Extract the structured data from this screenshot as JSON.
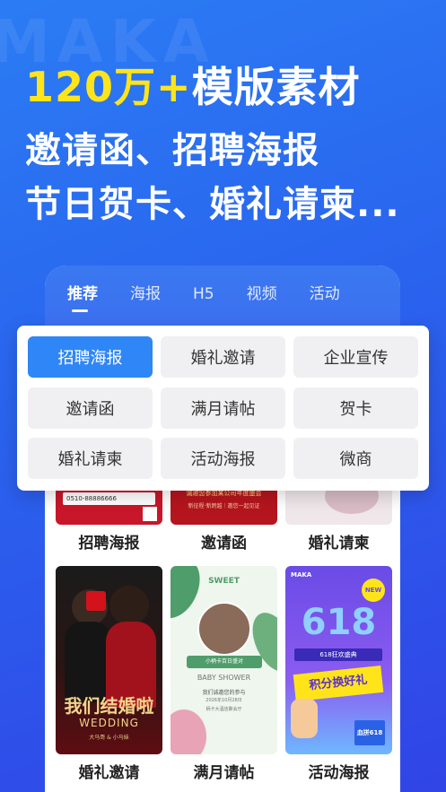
{
  "watermark": "MAKA",
  "hero": {
    "line1_accent": "120万+",
    "line1_rest": "模版素材",
    "line2": "邀请函、招聘海报",
    "line3": "节日贺卡、婚礼请柬..."
  },
  "tabs": [
    {
      "label": "推荐"
    },
    {
      "label": "海报"
    },
    {
      "label": "H5"
    },
    {
      "label": "视频"
    },
    {
      "label": "活动"
    }
  ],
  "categories": [
    {
      "label": "招聘海报"
    },
    {
      "label": "婚礼邀请"
    },
    {
      "label": "企业宣传"
    },
    {
      "label": "邀请函"
    },
    {
      "label": "满月请帖"
    },
    {
      "label": "贺卡"
    },
    {
      "label": "婚礼请柬"
    },
    {
      "label": "活动海报"
    },
    {
      "label": "微商"
    }
  ],
  "cards_row1": [
    {
      "label": "招聘海报",
      "snippet": "0510-88886666"
    },
    {
      "label": "邀请函",
      "snippet": "诚邀您参加某公司年度盛会",
      "snippet2": "新征程·新跨越｜邀您一起见证"
    },
    {
      "label": "婚礼请柬"
    }
  ],
  "cards_row2": [
    {
      "label": "婚礼邀请",
      "snippet": "我们结婚啦",
      "snippet2": "WEDDING",
      "snippet3": "大马哥 & 小马妹"
    },
    {
      "label": "满月请帖",
      "snippet": "SWEET",
      "snippet2": "小柄卡百日盛对",
      "snippet3": "BABY SHOWER",
      "snippet4": "我们诚邀您的参与",
      "snippet5": "2026年10月28日",
      "snippet6": "柄卡大酒店聚会厅"
    },
    {
      "label": "活动海报",
      "snippet": "MAKA",
      "snippet2": "NEW",
      "snippet3": "618",
      "snippet4": "618狂欢盛典",
      "snippet5": "积分换好礼",
      "snippet6": "血拼618"
    }
  ]
}
